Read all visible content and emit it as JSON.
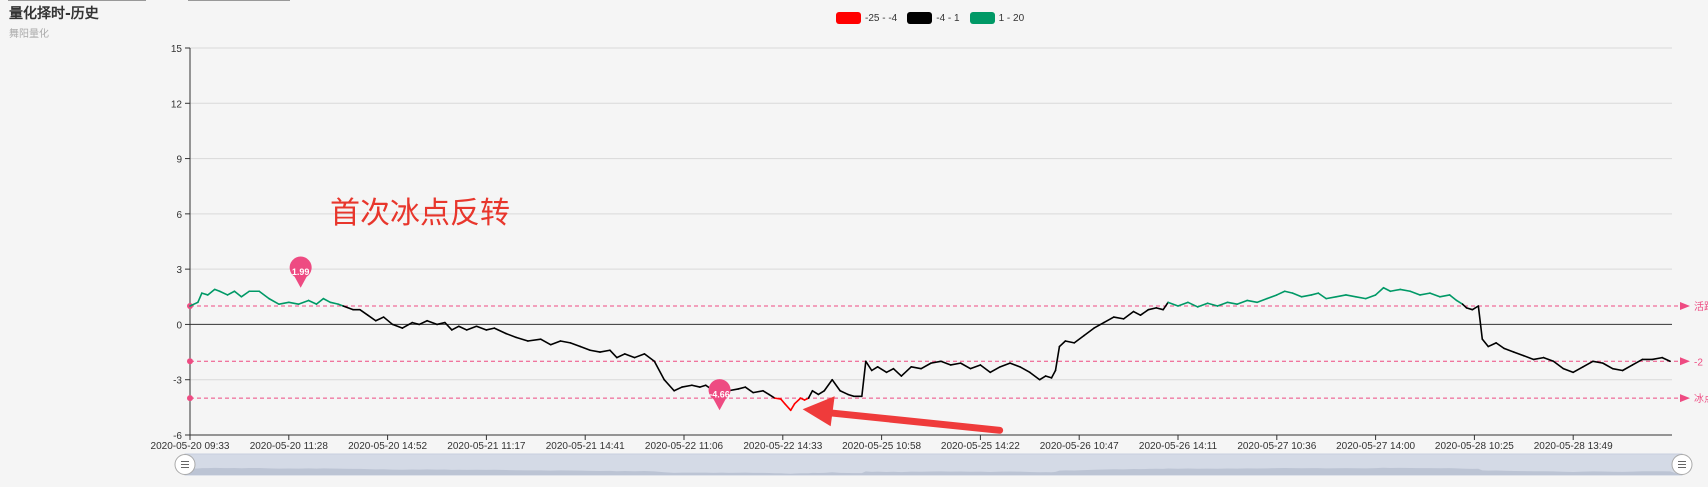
{
  "header": {
    "title": "量化择时-历史",
    "subtitle": "舞阳量化"
  },
  "legend": [
    {
      "label": "-25 - -4",
      "color": "#ff0000"
    },
    {
      "label": "-4 - 1",
      "color": "#000000"
    },
    {
      "label": "1 - 20",
      "color": "#009966"
    }
  ],
  "annotation_text": "首次冰点反转",
  "chart_data": {
    "type": "line",
    "ylim": [
      -6,
      15
    ],
    "yticks": [
      -6,
      -3,
      0,
      3,
      6,
      9,
      12,
      15
    ],
    "xticks": [
      "2020-05-20 09:33",
      "2020-05-20 11:28",
      "2020-05-20 14:52",
      "2020-05-21 11:17",
      "2020-05-21 14:41",
      "2020-05-22 11:06",
      "2020-05-22 14:33",
      "2020-05-25 10:58",
      "2020-05-25 14:22",
      "2020-05-26 10:47",
      "2020-05-26 14:11",
      "2020-05-27 10:36",
      "2020-05-27 14:00",
      "2020-05-28 10:25",
      "2020-05-28 13:49"
    ],
    "visual_map": [
      {
        "min": -25,
        "max": -4,
        "color": "#ff0000"
      },
      {
        "min": -4,
        "max": 1,
        "color": "#000000"
      },
      {
        "min": 1,
        "max": 20,
        "color": "#009966"
      }
    ],
    "mark_lines": [
      {
        "value": 1,
        "label": "活跃区"
      },
      {
        "value": -2,
        "label": "-2"
      },
      {
        "value": -4,
        "label": "冰点"
      }
    ],
    "mark_points": [
      {
        "x_index": 1.12,
        "value": 1.99,
        "label": "1.99"
      },
      {
        "x_index": 5.36,
        "value": -4.66,
        "label": "-4.66"
      }
    ],
    "series_points": [
      [
        0,
        1.0
      ],
      [
        0.08,
        1.2
      ],
      [
        0.12,
        1.7
      ],
      [
        0.18,
        1.6
      ],
      [
        0.25,
        1.9
      ],
      [
        0.3,
        1.8
      ],
      [
        0.38,
        1.6
      ],
      [
        0.45,
        1.8
      ],
      [
        0.52,
        1.5
      ],
      [
        0.6,
        1.8
      ],
      [
        0.7,
        1.8
      ],
      [
        0.8,
        1.4
      ],
      [
        0.9,
        1.1
      ],
      [
        1.0,
        1.2
      ],
      [
        1.1,
        1.1
      ],
      [
        1.2,
        1.3
      ],
      [
        1.28,
        1.1
      ],
      [
        1.35,
        1.4
      ],
      [
        1.42,
        1.2
      ],
      [
        1.5,
        1.1
      ],
      [
        1.55,
        1.0
      ],
      [
        1.65,
        0.8
      ],
      [
        1.72,
        0.8
      ],
      [
        1.8,
        0.5
      ],
      [
        1.88,
        0.2
      ],
      [
        1.96,
        0.4
      ],
      [
        2.05,
        0.0
      ],
      [
        2.15,
        -0.2
      ],
      [
        2.25,
        0.1
      ],
      [
        2.32,
        0.0
      ],
      [
        2.4,
        0.2
      ],
      [
        2.5,
        0.0
      ],
      [
        2.58,
        0.1
      ],
      [
        2.65,
        -0.3
      ],
      [
        2.72,
        -0.1
      ],
      [
        2.8,
        -0.3
      ],
      [
        2.9,
        -0.1
      ],
      [
        3.0,
        -0.3
      ],
      [
        3.08,
        -0.2
      ],
      [
        3.2,
        -0.5
      ],
      [
        3.3,
        -0.7
      ],
      [
        3.42,
        -0.9
      ],
      [
        3.55,
        -0.8
      ],
      [
        3.65,
        -1.1
      ],
      [
        3.75,
        -0.9
      ],
      [
        3.85,
        -1.0
      ],
      [
        3.95,
        -1.2
      ],
      [
        4.05,
        -1.4
      ],
      [
        4.15,
        -1.5
      ],
      [
        4.25,
        -1.4
      ],
      [
        4.32,
        -1.8
      ],
      [
        4.4,
        -1.6
      ],
      [
        4.5,
        -1.8
      ],
      [
        4.6,
        -1.6
      ],
      [
        4.7,
        -2.0
      ],
      [
        4.8,
        -3.0
      ],
      [
        4.9,
        -3.6
      ],
      [
        4.98,
        -3.4
      ],
      [
        5.08,
        -3.3
      ],
      [
        5.16,
        -3.4
      ],
      [
        5.22,
        -3.3
      ],
      [
        5.3,
        -3.6
      ],
      [
        5.38,
        -3.3
      ],
      [
        5.45,
        -3.6
      ],
      [
        5.55,
        -3.5
      ],
      [
        5.62,
        -3.4
      ],
      [
        5.7,
        -3.7
      ],
      [
        5.8,
        -3.6
      ],
      [
        5.86,
        -3.8
      ],
      [
        5.92,
        -4.0
      ],
      [
        5.98,
        -4.05
      ],
      [
        6.02,
        -4.3
      ],
      [
        6.08,
        -4.66
      ],
      [
        6.12,
        -4.3
      ],
      [
        6.18,
        -4.0
      ],
      [
        6.22,
        -4.1
      ],
      [
        6.26,
        -4.0
      ],
      [
        6.3,
        -3.6
      ],
      [
        6.36,
        -3.8
      ],
      [
        6.42,
        -3.6
      ],
      [
        6.5,
        -3.0
      ],
      [
        6.58,
        -3.6
      ],
      [
        6.66,
        -3.8
      ],
      [
        6.72,
        -3.9
      ],
      [
        6.8,
        -3.9
      ],
      [
        6.84,
        -2.0
      ],
      [
        6.9,
        -2.5
      ],
      [
        6.96,
        -2.3
      ],
      [
        7.05,
        -2.6
      ],
      [
        7.12,
        -2.4
      ],
      [
        7.2,
        -2.8
      ],
      [
        7.3,
        -2.3
      ],
      [
        7.4,
        -2.4
      ],
      [
        7.5,
        -2.1
      ],
      [
        7.6,
        -2.0
      ],
      [
        7.7,
        -2.2
      ],
      [
        7.8,
        -2.1
      ],
      [
        7.9,
        -2.4
      ],
      [
        8.0,
        -2.2
      ],
      [
        8.1,
        -2.6
      ],
      [
        8.2,
        -2.3
      ],
      [
        8.3,
        -2.1
      ],
      [
        8.4,
        -2.3
      ],
      [
        8.5,
        -2.6
      ],
      [
        8.6,
        -3.0
      ],
      [
        8.66,
        -2.8
      ],
      [
        8.72,
        -2.9
      ],
      [
        8.76,
        -2.5
      ],
      [
        8.8,
        -1.2
      ],
      [
        8.86,
        -0.9
      ],
      [
        8.95,
        -1.0
      ],
      [
        9.05,
        -0.6
      ],
      [
        9.15,
        -0.2
      ],
      [
        9.25,
        0.1
      ],
      [
        9.35,
        0.4
      ],
      [
        9.45,
        0.3
      ],
      [
        9.55,
        0.7
      ],
      [
        9.62,
        0.5
      ],
      [
        9.7,
        0.8
      ],
      [
        9.78,
        0.9
      ],
      [
        9.85,
        0.8
      ],
      [
        9.9,
        1.2
      ],
      [
        10.0,
        1.0
      ],
      [
        10.1,
        1.2
      ],
      [
        10.2,
        0.95
      ],
      [
        10.3,
        1.15
      ],
      [
        10.4,
        1.0
      ],
      [
        10.5,
        1.2
      ],
      [
        10.6,
        1.1
      ],
      [
        10.7,
        1.3
      ],
      [
        10.8,
        1.2
      ],
      [
        10.9,
        1.4
      ],
      [
        11.0,
        1.6
      ],
      [
        11.08,
        1.8
      ],
      [
        11.16,
        1.7
      ],
      [
        11.25,
        1.5
      ],
      [
        11.35,
        1.6
      ],
      [
        11.42,
        1.7
      ],
      [
        11.5,
        1.4
      ],
      [
        11.6,
        1.5
      ],
      [
        11.7,
        1.6
      ],
      [
        11.8,
        1.5
      ],
      [
        11.9,
        1.4
      ],
      [
        12.0,
        1.6
      ],
      [
        12.08,
        1.99
      ],
      [
        12.15,
        1.8
      ],
      [
        12.25,
        1.9
      ],
      [
        12.35,
        1.8
      ],
      [
        12.45,
        1.6
      ],
      [
        12.55,
        1.7
      ],
      [
        12.65,
        1.5
      ],
      [
        12.75,
        1.6
      ],
      [
        12.82,
        1.3
      ],
      [
        12.88,
        1.1
      ],
      [
        12.92,
        0.9
      ],
      [
        12.98,
        0.8
      ],
      [
        13.04,
        1.0
      ],
      [
        13.08,
        -0.8
      ],
      [
        13.14,
        -1.2
      ],
      [
        13.22,
        -1.0
      ],
      [
        13.3,
        -1.3
      ],
      [
        13.4,
        -1.5
      ],
      [
        13.5,
        -1.7
      ],
      [
        13.6,
        -1.9
      ],
      [
        13.7,
        -1.8
      ],
      [
        13.8,
        -2.0
      ],
      [
        13.9,
        -2.4
      ],
      [
        14.0,
        -2.6
      ],
      [
        14.1,
        -2.3
      ],
      [
        14.2,
        -2.0
      ],
      [
        14.3,
        -2.1
      ],
      [
        14.4,
        -2.4
      ],
      [
        14.5,
        -2.5
      ],
      [
        14.6,
        -2.2
      ],
      [
        14.7,
        -1.9
      ],
      [
        14.8,
        -1.9
      ],
      [
        14.9,
        -1.8
      ],
      [
        14.98,
        -2.0
      ]
    ]
  }
}
